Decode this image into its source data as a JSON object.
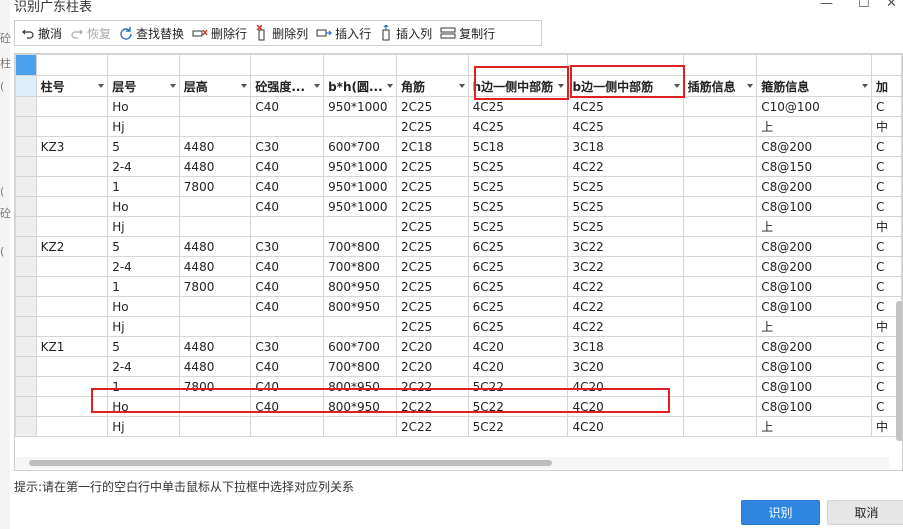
{
  "window": {
    "title": "识别广东柱表",
    "minimize_glyph": "—",
    "maximize_glyph": "☐",
    "close_glyph": "✕"
  },
  "left_strip_chars": [
    "砼",
    "柱",
    "(",
    "(",
    "砼",
    "("
  ],
  "toolbar": {
    "undo": "撤消",
    "redo": "恢复",
    "find_replace": "查找替换",
    "delete_row": "删除行",
    "delete_col": "删除列",
    "insert_row": "插入行",
    "insert_col": "插入列",
    "copy_row": "复制行"
  },
  "table": {
    "headers": [
      "柱号",
      "层号",
      "层高",
      "砼强度...",
      "b*h(圆...",
      "角筋",
      "h边一侧中部筋",
      "b边一侧中部筋",
      "插筋信息",
      "箍筋信息",
      "加"
    ],
    "rows": [
      [
        "",
        "Ho",
        "",
        "C40",
        "950*1000",
        "2C25",
        "4C25",
        "4C25",
        "",
        "C10@100",
        "C"
      ],
      [
        "",
        "Hj",
        "",
        "",
        "",
        "2C25",
        "4C25",
        "4C25",
        "",
        "上",
        "中"
      ],
      [
        "KZ3",
        "5",
        "4480",
        "C30",
        "600*700",
        "2C18",
        "5C18",
        "3C18",
        "",
        "C8@200",
        "C"
      ],
      [
        "",
        "2-4",
        "4480",
        "C40",
        "950*1000",
        "2C25",
        "5C25",
        "4C22",
        "",
        "C8@150",
        "C"
      ],
      [
        "",
        "1",
        "7800",
        "C40",
        "950*1000",
        "2C25",
        "5C25",
        "5C25",
        "",
        "C8@200",
        "C"
      ],
      [
        "",
        "Ho",
        "",
        "C40",
        "950*1000",
        "2C25",
        "5C25",
        "5C25",
        "",
        "C8@100",
        "C"
      ],
      [
        "",
        "Hj",
        "",
        "",
        "",
        "2C25",
        "5C25",
        "5C25",
        "",
        "上",
        "中"
      ],
      [
        "KZ2",
        "5",
        "4480",
        "C30",
        "700*800",
        "2C25",
        "6C25",
        "3C22",
        "",
        "C8@200",
        "C"
      ],
      [
        "",
        "2-4",
        "4480",
        "C40",
        "700*800",
        "2C25",
        "6C25",
        "3C22",
        "",
        "C8@200",
        "C"
      ],
      [
        "",
        "1",
        "7800",
        "C40",
        "800*950",
        "2C25",
        "6C25",
        "4C22",
        "",
        "C8@100",
        "C"
      ],
      [
        "",
        "Ho",
        "",
        "C40",
        "800*950",
        "2C25",
        "6C25",
        "4C22",
        "",
        "C8@100",
        "C"
      ],
      [
        "",
        "Hj",
        "",
        "",
        "",
        "2C25",
        "6C25",
        "4C22",
        "",
        "上",
        "中"
      ],
      [
        "KZ1",
        "5",
        "4480",
        "C30",
        "600*700",
        "2C20",
        "4C20",
        "3C18",
        "",
        "C8@200",
        "C"
      ],
      [
        "",
        "2-4",
        "4480",
        "C40",
        "700*800",
        "2C20",
        "4C20",
        "3C20",
        "",
        "C8@100",
        "C"
      ],
      [
        "",
        "1",
        "7800",
        "C40",
        "800*950",
        "2C22",
        "5C22",
        "4C20",
        "",
        "C8@100",
        "C"
      ],
      [
        "",
        "Ho",
        "",
        "C40",
        "800*950",
        "2C22",
        "5C22",
        "4C20",
        "",
        "C8@100",
        "C"
      ],
      [
        "",
        "Hj",
        "",
        "",
        "",
        "2C22",
        "5C22",
        "4C20",
        "",
        "上",
        "中"
      ]
    ]
  },
  "hint": "提示:请在第一行的空白行中单击鼠标从下拉框中选择对应列关系",
  "buttons": {
    "recognize": "识别",
    "cancel": "取消"
  },
  "colors": {
    "highlight_red": "#e02020",
    "primary_blue": "#2f86e0",
    "selected_row_header": "#4aa0ea"
  }
}
